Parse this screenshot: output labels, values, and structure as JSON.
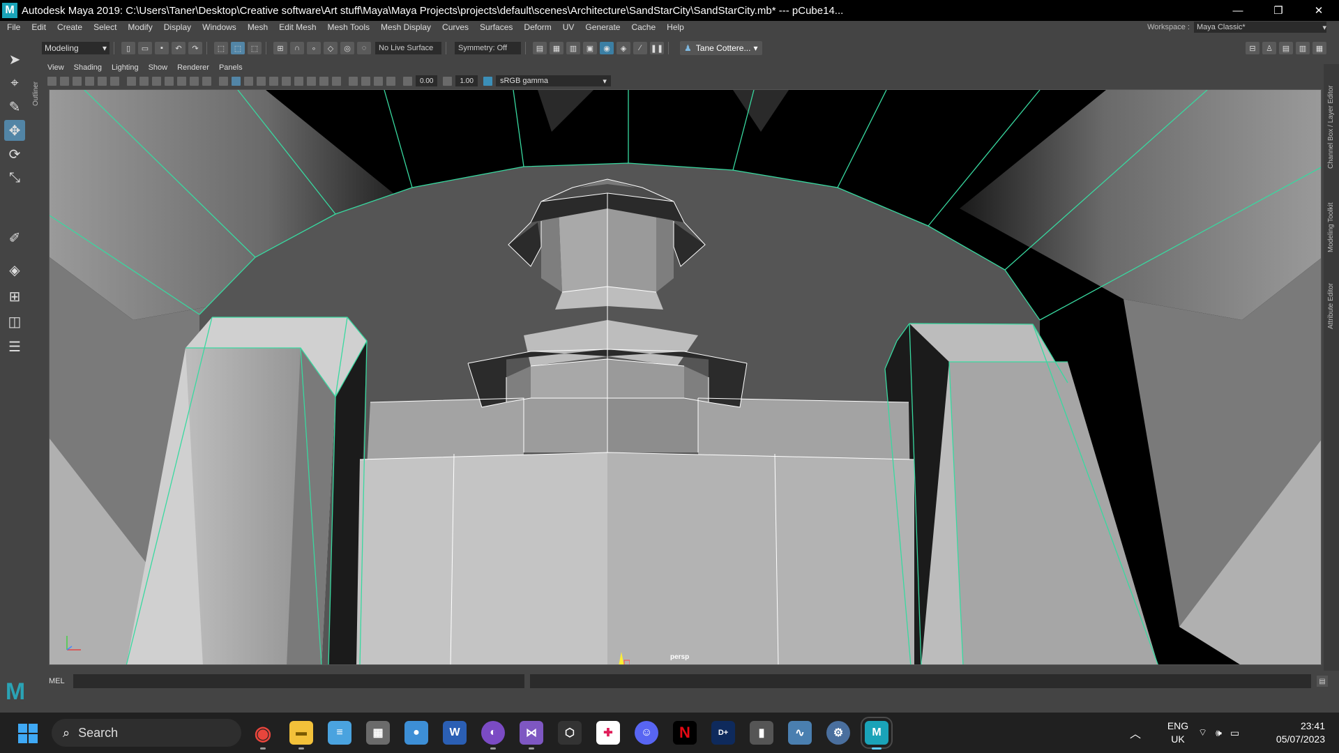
{
  "window": {
    "app_icon": "M",
    "title": "Autodesk Maya 2019: C:\\Users\\Taner\\Desktop\\Creative software\\Art stuff\\Maya\\Maya Projects\\projects\\default\\scenes\\Architecture\\SandStarCity\\SandStarCity.mb*   ---   pCube14...",
    "controls": [
      "—",
      "❐",
      "✕"
    ]
  },
  "menubar": {
    "items": [
      "File",
      "Edit",
      "Create",
      "Select",
      "Modify",
      "Display",
      "Windows",
      "Mesh",
      "Edit Mesh",
      "Mesh Tools",
      "Mesh Display",
      "Curves",
      "Surfaces",
      "Deform",
      "UV",
      "Generate",
      "Cache",
      "Help"
    ],
    "workspace_label": "Workspace :",
    "workspace_value": "Maya Classic*"
  },
  "statusline": {
    "mode": "Modeling",
    "live_surface": "No Live Surface",
    "symmetry": "Symmetry: Off",
    "user": "Tane Cottere..."
  },
  "sidetabs": {
    "left": "Outliner",
    "right": [
      "Channel Box / Layer Editor",
      "Modeling Toolkit",
      "Attribute Editor"
    ]
  },
  "panel": {
    "menus": [
      "View",
      "Shading",
      "Lighting",
      "Show",
      "Renderer",
      "Panels"
    ],
    "exposure": "0.00",
    "gamma": "1.00",
    "color_space": "sRGB gamma",
    "camera_label": "persp"
  },
  "cmdline": {
    "label": "MEL"
  },
  "taskbar": {
    "search_placeholder": "Search",
    "apps": [
      {
        "name": "chrome",
        "glyph": "◉",
        "color": "#e8453c"
      },
      {
        "name": "file-explorer",
        "glyph": "▬",
        "color": "#f3c13a"
      },
      {
        "name": "notepad",
        "glyph": "≡",
        "color": "#4aa3df"
      },
      {
        "name": "calculator",
        "glyph": "▦",
        "color": "#6b6b6b"
      },
      {
        "name": "paint",
        "glyph": "●",
        "color": "#3d8fd6"
      },
      {
        "name": "word",
        "glyph": "W",
        "color": "#2b5fb4"
      },
      {
        "name": "github",
        "glyph": "◐",
        "color": "#7b4bc4"
      },
      {
        "name": "visual-studio",
        "glyph": "⋈",
        "color": "#7e57c2"
      },
      {
        "name": "unity",
        "glyph": "⬡",
        "color": "#333333"
      },
      {
        "name": "slack",
        "glyph": "✚",
        "color": "#4a154b"
      },
      {
        "name": "discord",
        "glyph": "☺",
        "color": "#5865f2"
      },
      {
        "name": "netflix",
        "glyph": "N",
        "color": "#000000"
      },
      {
        "name": "disney-plus",
        "glyph": "D+",
        "color": "#0e2a5c"
      },
      {
        "name": "microphone",
        "glyph": "▮",
        "color": "#555555"
      },
      {
        "name": "monitor-app",
        "glyph": "∿",
        "color": "#4a7fb0"
      },
      {
        "name": "settings",
        "glyph": "⚙",
        "color": "#4a6f9e"
      },
      {
        "name": "maya",
        "glyph": "M",
        "color": "#1aa3b8"
      }
    ],
    "language": "ENG",
    "region": "UK",
    "time": "23:41",
    "date": "05/07/2023"
  }
}
